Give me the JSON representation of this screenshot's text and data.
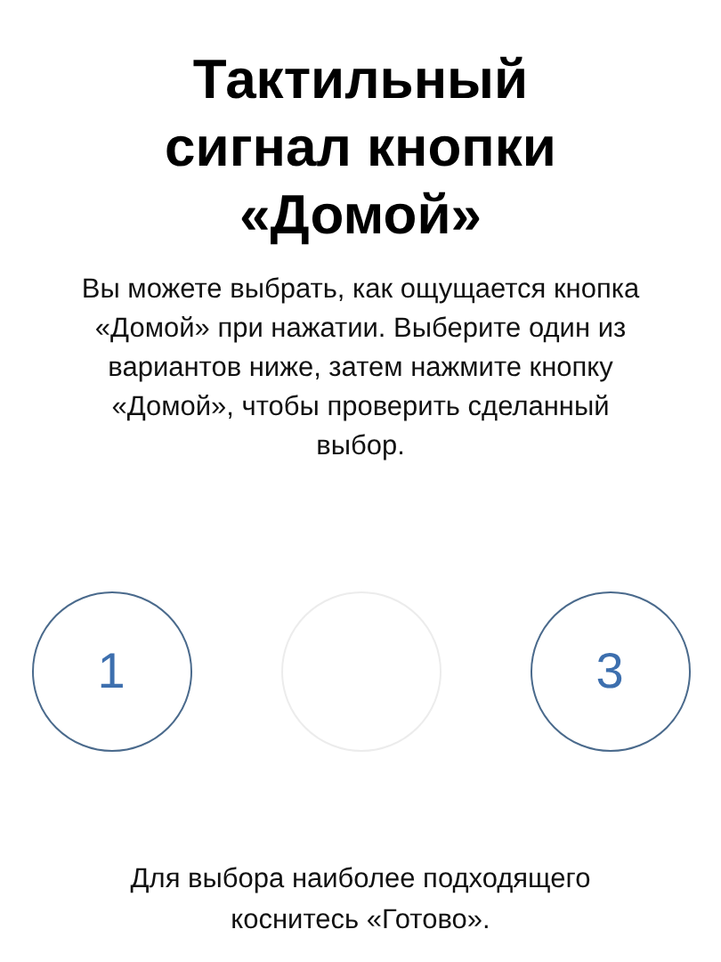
{
  "title": "Тактильный сигнал кнопки «Домой»",
  "description": "Вы можете выбрать, как ощущается кнопка «Домой» при нажатии. Выберите один из вариантов ниже, затем нажмите кнопку «Домой», чтобы проверить сделанный выбор.",
  "options": [
    {
      "label": "1",
      "selected": false
    },
    {
      "selected": true
    },
    {
      "label": "3",
      "selected": false
    }
  ],
  "footer": "Для выбора наиболее подходящего коснитесь «Готово»."
}
